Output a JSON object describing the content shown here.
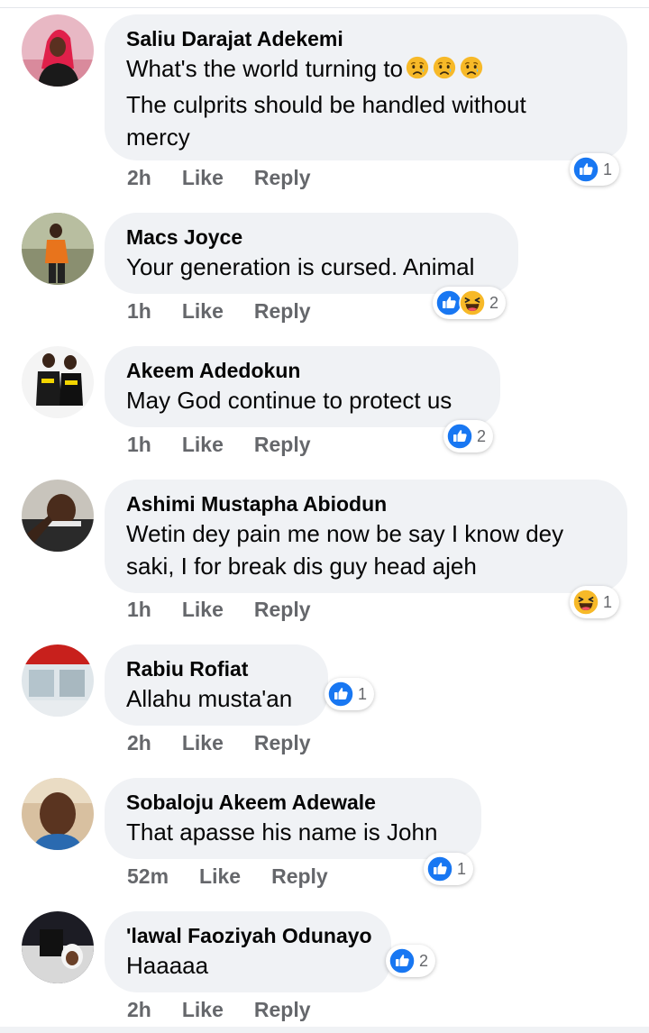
{
  "comments": [
    {
      "name": "Saliu Darajat Adekemi",
      "text1": "What's the world turning to",
      "text2": "The culprits should be handled without",
      "text3": "mercy",
      "time": "2h",
      "like": "Like",
      "reply": "Reply",
      "reaction_count": "1",
      "reactions": [
        "like-icon"
      ]
    },
    {
      "name": "Macs Joyce",
      "text1": "Your generation is cursed. Animal",
      "time": "1h",
      "like": "Like",
      "reply": "Reply",
      "reaction_count": "2",
      "reactions": [
        "like-icon",
        "haha-icon"
      ]
    },
    {
      "name": "Akeem Adedokun",
      "text1": "May God continue to protect us",
      "time": "1h",
      "like": "Like",
      "reply": "Reply",
      "reaction_count": "2",
      "reactions": [
        "like-icon"
      ]
    },
    {
      "name": "Ashimi Mustapha Abiodun",
      "text1": "Wetin dey pain me now be say I know dey",
      "text2": "saki, I for break dis guy head ajeh",
      "time": "1h",
      "like": "Like",
      "reply": "Reply",
      "reaction_count": "1",
      "reactions": [
        "haha-icon"
      ]
    },
    {
      "name": "Rabiu Rofiat",
      "text1": "Allahu musta'an",
      "time": "2h",
      "like": "Like",
      "reply": "Reply",
      "reaction_count": "1",
      "reactions": [
        "like-icon"
      ]
    },
    {
      "name": "Sobaloju Akeem Adewale",
      "text1": "That apasse his name is John",
      "time": "52m",
      "like": "Like",
      "reply": "Reply",
      "reaction_count": "1",
      "reactions": [
        "like-icon"
      ]
    },
    {
      "name": "'lawal Faoziyah Odunayo",
      "text1": "Haaaaa",
      "time": "2h",
      "like": "Like",
      "reply": "Reply",
      "reaction_count": "2",
      "reactions": [
        "like-icon"
      ]
    }
  ],
  "colors": {
    "bubble": "#f0f2f5",
    "like_blue": "#1877f2",
    "haha_yellow": "#f7b928",
    "meta_gray": "#65676b"
  }
}
